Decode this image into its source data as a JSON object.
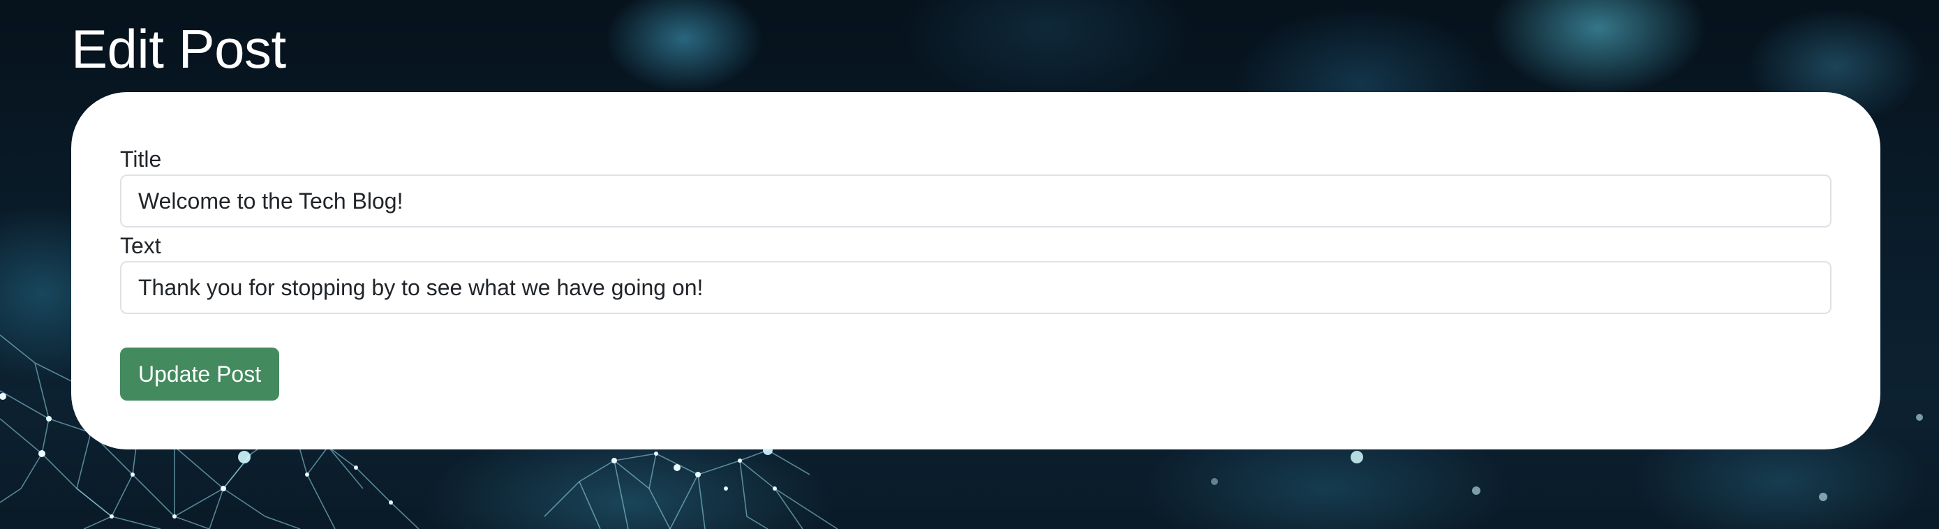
{
  "page": {
    "title": "Edit Post"
  },
  "form": {
    "title_label": "Title",
    "title_value": "Welcome to the Tech Blog!",
    "text_label": "Text",
    "text_value": "Thank you for stopping by to see what we have going on!",
    "submit_label": "Update Post"
  },
  "colors": {
    "button": "#438a5e",
    "card": "#ffffff",
    "background": "#0a1c2a"
  }
}
